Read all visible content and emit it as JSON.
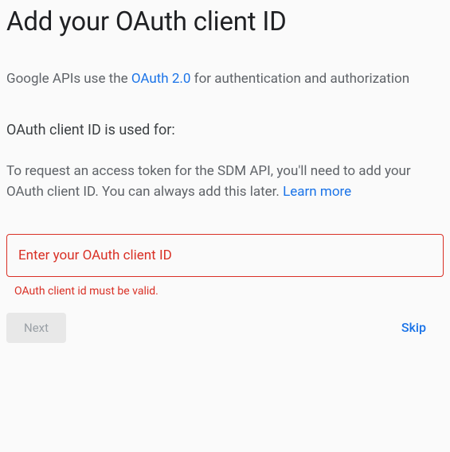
{
  "title": "Add your OAuth client ID",
  "intro": {
    "before_link": "Google APIs use the ",
    "link_text": "OAuth 2.0",
    "after_link": " for authentication and authorization"
  },
  "subheading": "OAuth client ID is used for:",
  "description": {
    "before_link": "To request an access token for the SDM API, you'll need to add your OAuth client ID. You can always add this later. ",
    "link_text": "Learn more"
  },
  "input": {
    "placeholder": "Enter your OAuth client ID",
    "value": ""
  },
  "error_message": "OAuth client id must be valid.",
  "buttons": {
    "next": "Next",
    "skip": "Skip"
  }
}
